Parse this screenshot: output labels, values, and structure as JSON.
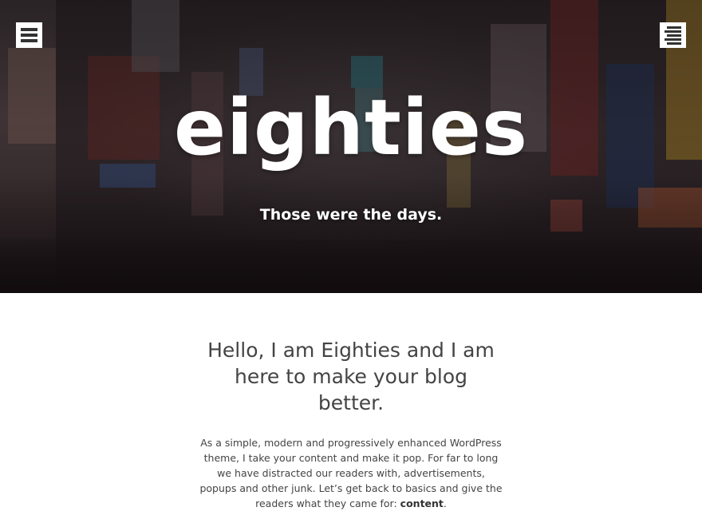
{
  "header": {
    "site_title": "eighties",
    "tagline": "Those were the days.",
    "left_menu_icon": "hamburger-menu-icon",
    "right_menu_icon": "right-aligned-menu-icon"
  },
  "intro": {
    "heading": "Hello, I am Eighties and I am here to make your blog better.",
    "body_prefix": "As a simple, modern and progressively enhanced WordPress theme, I take your content and make it pop. For far to long we have distracted our readers with, advertisements, popups and other junk. Let’s get back to basics and give the readers what they came for: ",
    "body_emphasis": "content",
    "body_suffix": "."
  },
  "colors": {
    "text": "#444444",
    "button_bg": "#ffffff",
    "button_icon": "#333333"
  }
}
